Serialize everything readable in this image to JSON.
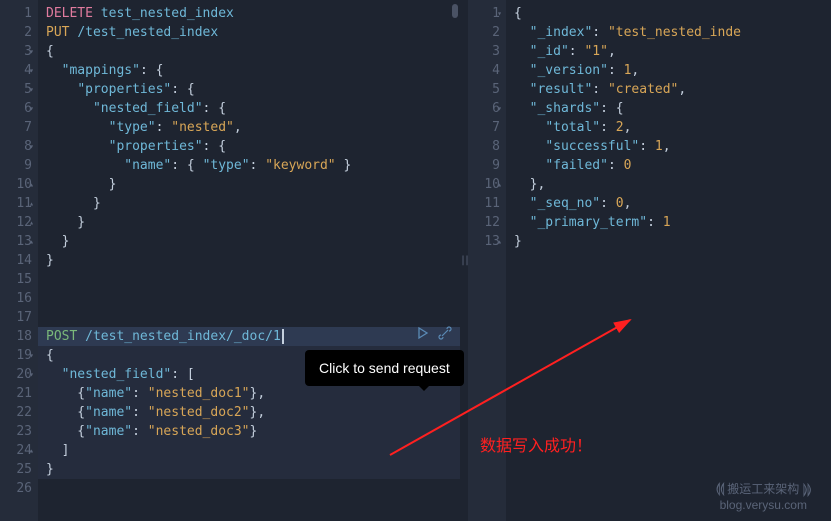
{
  "tooltip": "Click to send request",
  "annotation": "数据写入成功！",
  "watermark_line1": "搬运工来架构",
  "watermark_line2": "blog.verysu.com",
  "left_lines": [
    {
      "n": "1",
      "segs": [
        {
          "t": "DELETE",
          "c": "kw-delete"
        },
        {
          "t": " "
        },
        {
          "t": "test_nested_index",
          "c": "path"
        }
      ]
    },
    {
      "n": "2",
      "segs": [
        {
          "t": "PUT",
          "c": "kw-put"
        },
        {
          "t": " "
        },
        {
          "t": "/test_nested_index",
          "c": "path"
        }
      ]
    },
    {
      "n": "3",
      "fold": "▾",
      "segs": [
        {
          "t": "{",
          "c": "brace"
        }
      ]
    },
    {
      "n": "4",
      "fold": "▾",
      "segs": [
        {
          "t": "  "
        },
        {
          "t": "\"mappings\"",
          "c": "key"
        },
        {
          "t": ": {",
          "c": "punc"
        }
      ]
    },
    {
      "n": "5",
      "fold": "▾",
      "segs": [
        {
          "t": "    "
        },
        {
          "t": "\"properties\"",
          "c": "key"
        },
        {
          "t": ": {",
          "c": "punc"
        }
      ]
    },
    {
      "n": "6",
      "fold": "▾",
      "segs": [
        {
          "t": "      "
        },
        {
          "t": "\"nested_field\"",
          "c": "key"
        },
        {
          "t": ": {",
          "c": "punc"
        }
      ]
    },
    {
      "n": "7",
      "segs": [
        {
          "t": "        "
        },
        {
          "t": "\"type\"",
          "c": "key"
        },
        {
          "t": ": ",
          "c": "punc"
        },
        {
          "t": "\"nested\"",
          "c": "str"
        },
        {
          "t": ",",
          "c": "punc"
        }
      ]
    },
    {
      "n": "8",
      "fold": "▾",
      "segs": [
        {
          "t": "        "
        },
        {
          "t": "\"properties\"",
          "c": "key"
        },
        {
          "t": ": {",
          "c": "punc"
        }
      ]
    },
    {
      "n": "9",
      "segs": [
        {
          "t": "          "
        },
        {
          "t": "\"name\"",
          "c": "key"
        },
        {
          "t": ": { ",
          "c": "punc"
        },
        {
          "t": "\"type\"",
          "c": "key"
        },
        {
          "t": ": ",
          "c": "punc"
        },
        {
          "t": "\"keyword\"",
          "c": "str"
        },
        {
          "t": " }",
          "c": "punc"
        }
      ]
    },
    {
      "n": "10",
      "fold": "▴",
      "segs": [
        {
          "t": "        }",
          "c": "brace"
        }
      ]
    },
    {
      "n": "11",
      "fold": "▴",
      "segs": [
        {
          "t": "      }",
          "c": "brace"
        }
      ]
    },
    {
      "n": "12",
      "fold": "▴",
      "segs": [
        {
          "t": "    }",
          "c": "brace"
        }
      ]
    },
    {
      "n": "13",
      "fold": "▴",
      "segs": [
        {
          "t": "  }",
          "c": "brace"
        }
      ]
    },
    {
      "n": "14",
      "segs": [
        {
          "t": "}",
          "c": "brace"
        }
      ]
    },
    {
      "n": "15",
      "segs": []
    },
    {
      "n": "16",
      "segs": []
    },
    {
      "n": "17",
      "segs": []
    },
    {
      "n": "18",
      "hl": true,
      "cursor": true,
      "segs": [
        {
          "t": "POST",
          "c": "kw-post"
        },
        {
          "t": " "
        },
        {
          "t": "/test_nested_index/_doc/1",
          "c": "path"
        }
      ]
    },
    {
      "n": "19",
      "fold": "▾",
      "segs": [
        {
          "t": "{",
          "c": "brace"
        }
      ]
    },
    {
      "n": "20",
      "fold": "▾",
      "segs": [
        {
          "t": "  "
        },
        {
          "t": "\"nested_field\"",
          "c": "key"
        },
        {
          "t": ": [",
          "c": "punc"
        }
      ]
    },
    {
      "n": "21",
      "segs": [
        {
          "t": "    {"
        },
        {
          "t": "\"name\"",
          "c": "key"
        },
        {
          "t": ": ",
          "c": "punc"
        },
        {
          "t": "\"nested_doc1\"",
          "c": "str"
        },
        {
          "t": "},",
          "c": "punc"
        }
      ]
    },
    {
      "n": "22",
      "segs": [
        {
          "t": "    {"
        },
        {
          "t": "\"name\"",
          "c": "key"
        },
        {
          "t": ": ",
          "c": "punc"
        },
        {
          "t": "\"nested_doc2\"",
          "c": "str"
        },
        {
          "t": "},",
          "c": "punc"
        }
      ]
    },
    {
      "n": "23",
      "segs": [
        {
          "t": "    {"
        },
        {
          "t": "\"name\"",
          "c": "key"
        },
        {
          "t": ": ",
          "c": "punc"
        },
        {
          "t": "\"nested_doc3\"",
          "c": "str"
        },
        {
          "t": "}",
          "c": "punc"
        }
      ]
    },
    {
      "n": "24",
      "fold": "▴",
      "segs": [
        {
          "t": "  ]",
          "c": "brace"
        }
      ]
    },
    {
      "n": "25",
      "segs": [
        {
          "t": "}",
          "c": "brace"
        }
      ]
    },
    {
      "n": "26",
      "segs": []
    }
  ],
  "right_lines": [
    {
      "n": "1",
      "fold": "▾",
      "segs": [
        {
          "t": "{",
          "c": "brace"
        }
      ]
    },
    {
      "n": "2",
      "segs": [
        {
          "t": "  "
        },
        {
          "t": "\"_index\"",
          "c": "key"
        },
        {
          "t": ": ",
          "c": "punc"
        },
        {
          "t": "\"test_nested_inde",
          "c": "str"
        }
      ]
    },
    {
      "n": "3",
      "segs": [
        {
          "t": "  "
        },
        {
          "t": "\"_id\"",
          "c": "key"
        },
        {
          "t": ": ",
          "c": "punc"
        },
        {
          "t": "\"1\"",
          "c": "str"
        },
        {
          "t": ",",
          "c": "punc"
        }
      ]
    },
    {
      "n": "4",
      "segs": [
        {
          "t": "  "
        },
        {
          "t": "\"_version\"",
          "c": "key"
        },
        {
          "t": ": ",
          "c": "punc"
        },
        {
          "t": "1",
          "c": "num"
        },
        {
          "t": ",",
          "c": "punc"
        }
      ]
    },
    {
      "n": "5",
      "segs": [
        {
          "t": "  "
        },
        {
          "t": "\"result\"",
          "c": "key"
        },
        {
          "t": ": ",
          "c": "punc"
        },
        {
          "t": "\"created\"",
          "c": "str"
        },
        {
          "t": ",",
          "c": "punc"
        }
      ]
    },
    {
      "n": "6",
      "fold": "▾",
      "segs": [
        {
          "t": "  "
        },
        {
          "t": "\"_shards\"",
          "c": "key"
        },
        {
          "t": ": {",
          "c": "punc"
        }
      ]
    },
    {
      "n": "7",
      "segs": [
        {
          "t": "    "
        },
        {
          "t": "\"total\"",
          "c": "key"
        },
        {
          "t": ": ",
          "c": "punc"
        },
        {
          "t": "2",
          "c": "num"
        },
        {
          "t": ",",
          "c": "punc"
        }
      ]
    },
    {
      "n": "8",
      "segs": [
        {
          "t": "    "
        },
        {
          "t": "\"successful\"",
          "c": "key"
        },
        {
          "t": ": ",
          "c": "punc"
        },
        {
          "t": "1",
          "c": "num"
        },
        {
          "t": ",",
          "c": "punc"
        }
      ]
    },
    {
      "n": "9",
      "segs": [
        {
          "t": "    "
        },
        {
          "t": "\"failed\"",
          "c": "key"
        },
        {
          "t": ": ",
          "c": "punc"
        },
        {
          "t": "0",
          "c": "num"
        }
      ]
    },
    {
      "n": "10",
      "fold": "▴",
      "segs": [
        {
          "t": "  },",
          "c": "brace"
        }
      ]
    },
    {
      "n": "11",
      "segs": [
        {
          "t": "  "
        },
        {
          "t": "\"_seq_no\"",
          "c": "key"
        },
        {
          "t": ": ",
          "c": "punc"
        },
        {
          "t": "0",
          "c": "num"
        },
        {
          "t": ",",
          "c": "punc"
        }
      ]
    },
    {
      "n": "12",
      "segs": [
        {
          "t": "  "
        },
        {
          "t": "\"_primary_term\"",
          "c": "key"
        },
        {
          "t": ": ",
          "c": "punc"
        },
        {
          "t": "1",
          "c": "num"
        }
      ]
    },
    {
      "n": "13",
      "fold": "▴",
      "segs": [
        {
          "t": "}",
          "c": "brace"
        }
      ]
    }
  ]
}
